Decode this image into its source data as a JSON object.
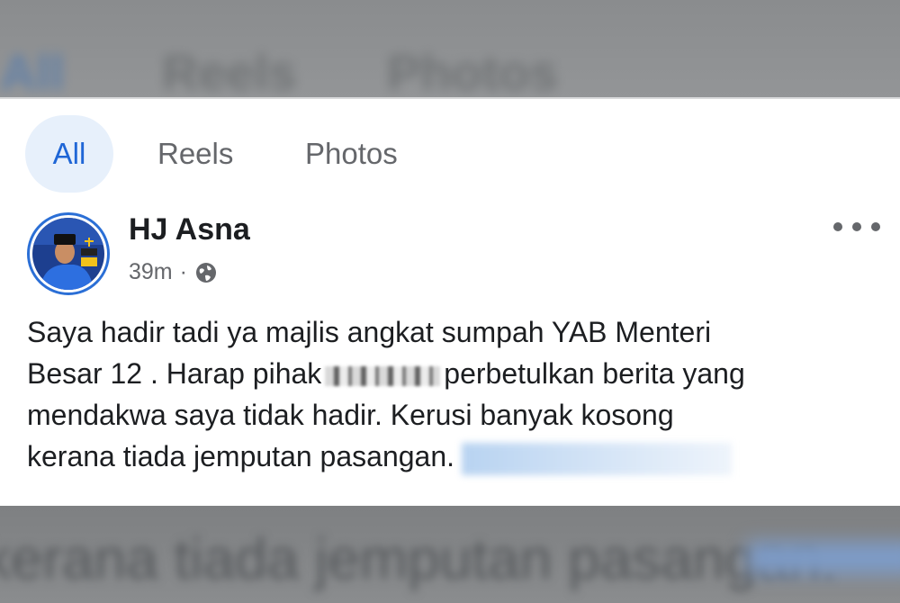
{
  "tabs": [
    {
      "label": "All",
      "active": true
    },
    {
      "label": "Reels",
      "active": false
    },
    {
      "label": "Photos",
      "active": false
    }
  ],
  "post": {
    "author": "HJ Asna",
    "time": "39m",
    "separator": "·",
    "audience_icon": "globe-icon",
    "menu_icon": "more-options-icon",
    "text_lines": [
      "Saya hadir tadi ya majlis angkat sumpah YAB Menteri",
      "Besar 12 . Harap pihak",
      "perbetulkan berita yang",
      "mendakwa saya tidak hadir. Kerusi banyak kosong",
      "kerana tiada jemputan pasangan."
    ]
  },
  "colors": {
    "accent": "#1f66d6",
    "tab_active_bg": "#e7f0fb",
    "text_primary": "#1c1e21",
    "text_secondary": "#65676b"
  }
}
